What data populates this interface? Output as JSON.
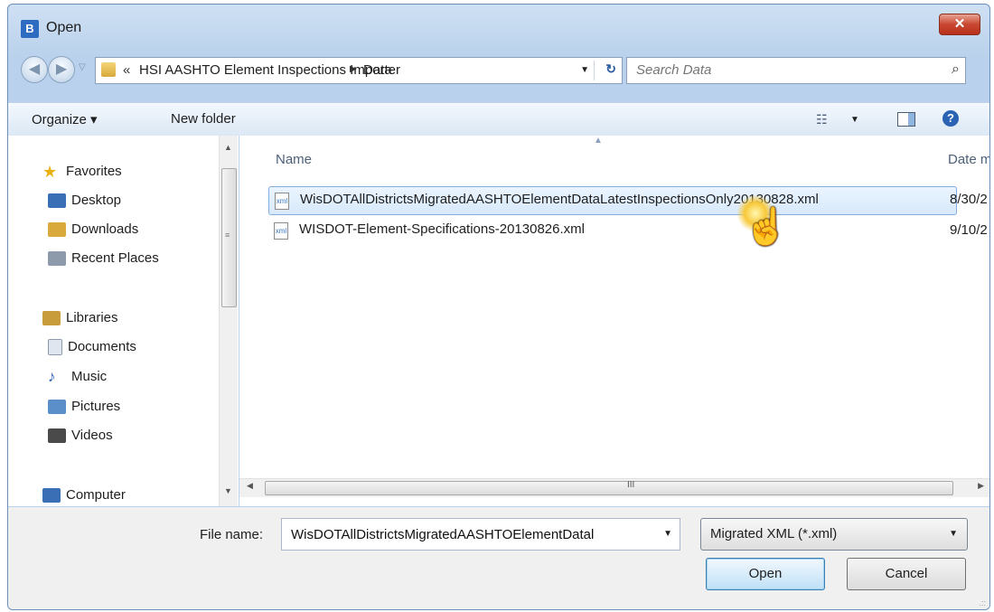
{
  "window": {
    "title": "Open",
    "app_icon_glyph": "B",
    "close_glyph": "✕"
  },
  "nav": {
    "back_glyph": "◀",
    "forward_glyph": "▶",
    "dropdown_glyph": "▽"
  },
  "address": {
    "chevron": "«",
    "crumbs": [
      "HSI AASHTO Element Inspections Importer",
      "Data"
    ],
    "separator": "▶",
    "dropdown_glyph": "▼",
    "refresh_glyph": "↻"
  },
  "search": {
    "placeholder": "Search Data",
    "icon_glyph": "⌕"
  },
  "toolbar": {
    "organize_label": "Organize ▾",
    "new_folder_label": "New folder",
    "views_glyph": "☷",
    "views_dropdown_glyph": "▼",
    "help_glyph": "?"
  },
  "sidebar": {
    "items": [
      {
        "label": "Favorites",
        "icon": "star-icon"
      },
      {
        "label": "Desktop",
        "icon": "desktop-icon",
        "color": "#3a6fb5"
      },
      {
        "label": "Downloads",
        "icon": "downloads-icon",
        "color": "#d9a93b"
      },
      {
        "label": "Recent Places",
        "icon": "recent-places-icon",
        "color": "#8c9aab"
      },
      {
        "label": "Libraries",
        "icon": "libraries-icon",
        "color": "#c89c3a"
      },
      {
        "label": "Documents",
        "icon": "documents-icon",
        "color": "#dfe6ef"
      },
      {
        "label": "Music",
        "icon": "music-icon",
        "color": "#2a63b3"
      },
      {
        "label": "Pictures",
        "icon": "pictures-icon",
        "color": "#5a8fc9"
      },
      {
        "label": "Videos",
        "icon": "videos-icon",
        "color": "#4a4a4a"
      },
      {
        "label": "Computer",
        "icon": "computer-icon",
        "color": "#3a6fb5"
      }
    ],
    "scroll_grip": "≡",
    "up_arrow": "▲",
    "down_arrow": "▼"
  },
  "files": {
    "columns": {
      "name": "Name",
      "date": "Date m"
    },
    "sort_glyph": "▲",
    "rows": [
      {
        "name": "WisDOTAllDistrictsMigratedAASHTOElementDataLatestInspectionsOnly20130828.xml",
        "date": "8/30/2",
        "selected": true
      },
      {
        "name": "WISDOT-Element-Specifications-20130826.xml",
        "date": "9/10/2",
        "selected": false
      }
    ],
    "file_icon_text": "xml",
    "hscroll_grip": "III",
    "left_arrow": "◀",
    "right_arrow": "▶"
  },
  "cursor": {
    "glyph": "☝"
  },
  "footer": {
    "file_name_label": "File name:",
    "file_name_value": "WisDOTAllDistrictsMigratedAASHTOElementDatal",
    "file_name_dropdown": "▼",
    "filter_value": "Migrated XML (*.xml)",
    "filter_dropdown": "▼",
    "open_label": "Open",
    "cancel_label": "Cancel",
    "resize_grip": ".::"
  }
}
